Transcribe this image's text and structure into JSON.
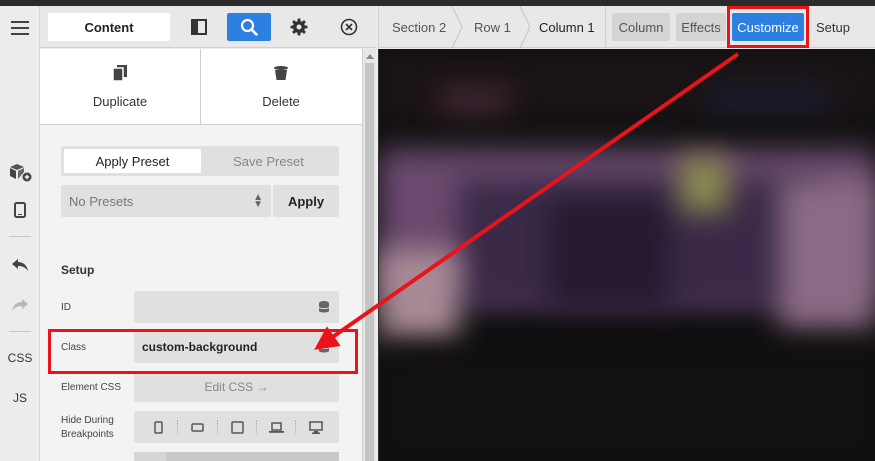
{
  "header": {
    "content_tab": "Content",
    "icons": [
      "sidebar-toggle-icon",
      "search-icon",
      "gear-icon",
      "close-circle-icon"
    ]
  },
  "rail": {
    "css_label": "CSS",
    "js_label": "JS"
  },
  "actions": {
    "duplicate": "Duplicate",
    "delete": "Delete"
  },
  "preset": {
    "apply_preset": "Apply Preset",
    "save_preset": "Save Preset",
    "select_value": "No Presets",
    "apply_button": "Apply"
  },
  "setup": {
    "title": "Setup",
    "id_label": "ID",
    "id_value": "",
    "class_label": "Class",
    "class_value": "custom-background",
    "element_css_label": "Element CSS",
    "edit_css": "Edit CSS →",
    "hide_during_line1": "Hide During",
    "hide_during_line2": "Breakpoints"
  },
  "breadcrumbs": {
    "items": [
      "Section 2",
      "Row 1",
      "Column 1"
    ],
    "tabs": [
      "Column",
      "Effects",
      "Customize"
    ],
    "active_tab": "Customize",
    "setup": "Setup"
  },
  "colors": {
    "accent": "#2d7fe0",
    "annotation": "#e8141a"
  }
}
